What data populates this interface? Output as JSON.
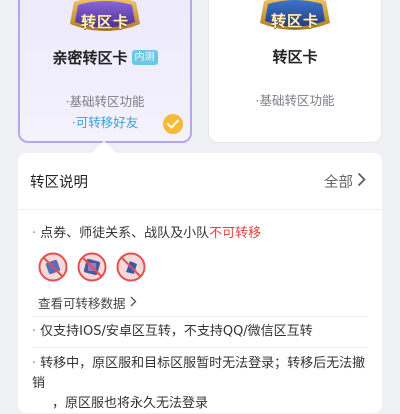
{
  "cards": [
    {
      "badge_text": "转区卡",
      "title": "亲密转区卡",
      "tag": "内测",
      "features": [
        "·基础转区功能",
        "·可转移好友"
      ],
      "selected": true
    },
    {
      "badge_text": "转区卡",
      "title": "转区卡",
      "features": [
        "·基础转区功能"
      ],
      "selected": false
    }
  ],
  "panel": {
    "title": "转区说明",
    "more_label": "全部",
    "items": [
      {
        "text": "点券、师徒关系、战队及小队",
        "warn": "不可转移"
      },
      {
        "text": "仅支持IOS/安卓区互转，不支持QQ/微信区互转"
      },
      {
        "text_line1": "转移中，原区服和目标区服暂时无法登录；转移后无法撤销",
        "text_line2": "，原区服也将永久无法登录"
      }
    ],
    "view_link": "查看可转移数据",
    "icons": [
      "ticket-icon",
      "mentor-icon",
      "team-icon"
    ],
    "colors": {
      "warn": "#e0463f",
      "accent": "#3aa0d8",
      "check": "#f6b93a"
    }
  }
}
